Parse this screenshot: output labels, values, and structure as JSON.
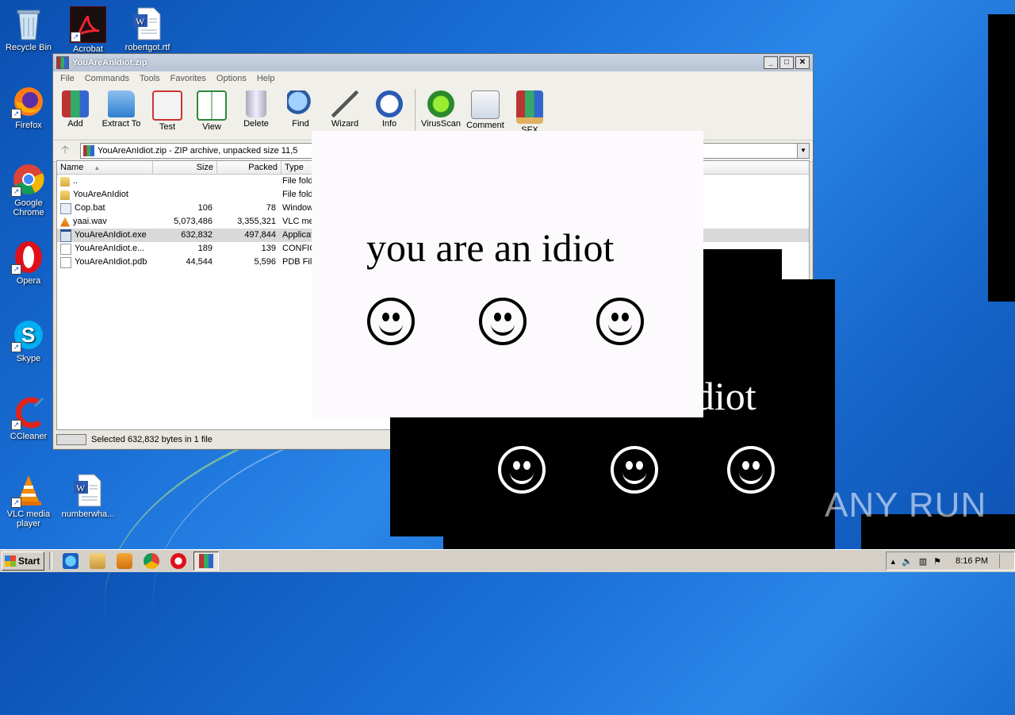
{
  "desktop": {
    "icons": [
      {
        "label": "Recycle Bin"
      },
      {
        "label": "Acrobat"
      },
      {
        "label": "robertgot.rtf"
      },
      {
        "label": "Firefox"
      },
      {
        "label": "Google Chrome"
      },
      {
        "label": "Opera"
      },
      {
        "label": "Skype"
      },
      {
        "label": "CCleaner"
      },
      {
        "label": "VLC media player"
      },
      {
        "label": "numberwha..."
      }
    ]
  },
  "window": {
    "title": "YouAreAnIdiot.zip",
    "menu": [
      "File",
      "Commands",
      "Tools",
      "Favorites",
      "Options",
      "Help"
    ],
    "toolbar": [
      "Add",
      "Extract To",
      "Test",
      "View",
      "Delete",
      "Find",
      "Wizard",
      "Info",
      "VirusScan",
      "Comment",
      "SFX"
    ],
    "address": "YouAreAnIdiot.zip - ZIP archive, unpacked size 11,5",
    "columns": [
      "Name",
      "Size",
      "Packed",
      "Type"
    ],
    "rows": [
      {
        "name": "..",
        "size": "",
        "packed": "",
        "type": "File fold",
        "icon": "folder-icon"
      },
      {
        "name": "YouAreAnIdiot",
        "size": "",
        "packed": "",
        "type": "File fold",
        "icon": "folder-icon"
      },
      {
        "name": "Cop.bat",
        "size": "106",
        "packed": "78",
        "type": "Window",
        "icon": "batch-file-icon"
      },
      {
        "name": "yaai.wav",
        "size": "5,073,486",
        "packed": "3,355,321",
        "type": "VLC me",
        "icon": "vlc-file-icon"
      },
      {
        "name": "YouAreAnIdiot.exe",
        "size": "632,832",
        "packed": "497,844",
        "type": "Applicat",
        "icon": "exe-file-icon",
        "selected": true
      },
      {
        "name": "YouAreAnIdiot.e...",
        "size": "189",
        "packed": "139",
        "type": "CONFIG",
        "icon": "config-file-icon"
      },
      {
        "name": "YouAreAnIdiot.pdb",
        "size": "44,544",
        "packed": "5,596",
        "type": "PDB File",
        "icon": "pdb-file-icon"
      }
    ],
    "status": "Selected 632,832 bytes in 1 file"
  },
  "popup_front": {
    "text": "you are an idiot"
  },
  "popup_back": {
    "text": "idiot"
  },
  "taskbar": {
    "start_label": "Start",
    "clock": "8:16 PM"
  },
  "watermark": "ANY RUN"
}
